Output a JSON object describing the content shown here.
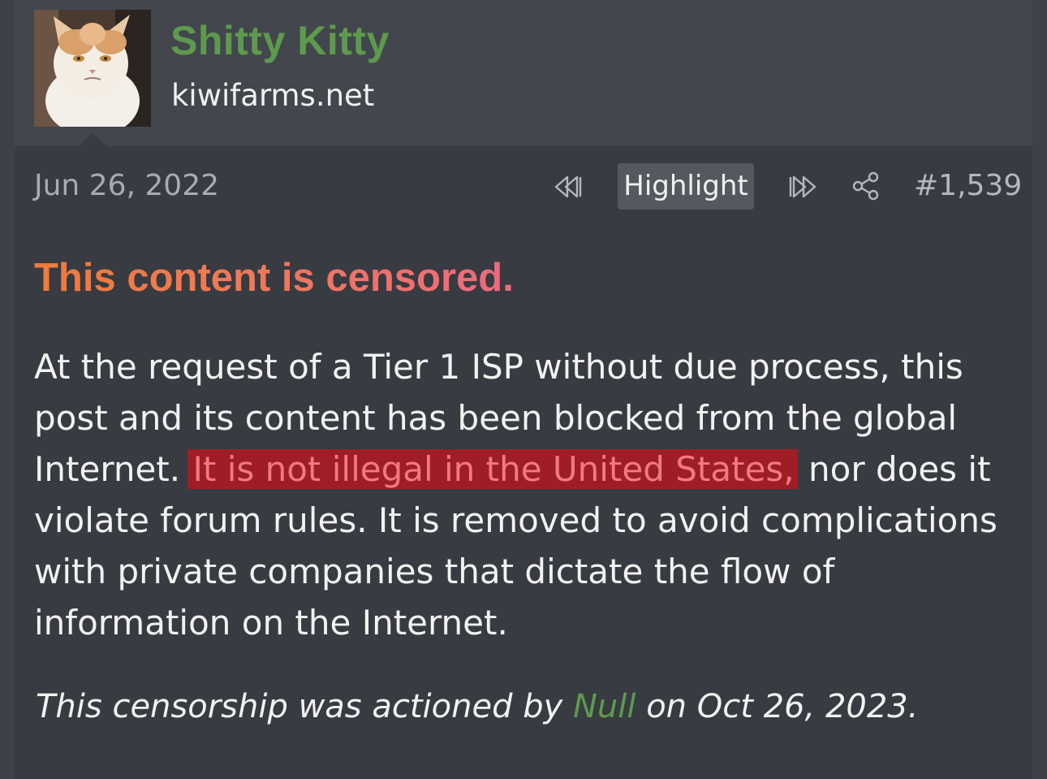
{
  "post": {
    "author": "Shitty Kitty",
    "site": "kiwifarms.net",
    "date": "Jun 26, 2022",
    "highlight_label": "Highlight",
    "post_number": "#1,539"
  },
  "icons": {
    "previous": "rewind-icon",
    "next": "fast-forward-icon",
    "share": "share-icon"
  },
  "notice": {
    "title": "This content is censored.",
    "body_before": "At the request of a Tier 1 ISP without due process, this post and its content has been blocked from the global Internet.",
    "body_highlight": "It is not illegal in the United States,",
    "body_after": "nor does it violate forum rules. It is removed to avoid complications with private companies that dictate the flow of information on the Internet.",
    "footer_before": "This censorship was actioned by",
    "footer_moderator": "Null",
    "footer_after": "on Oct 26, 2023."
  },
  "colors": {
    "username": "#5e9a4d",
    "title_gradient_start": "#ef7b3a",
    "title_gradient_end": "#ed6a80",
    "highlight_bg": "#9f1d24",
    "highlight_text": "#f07a80"
  }
}
